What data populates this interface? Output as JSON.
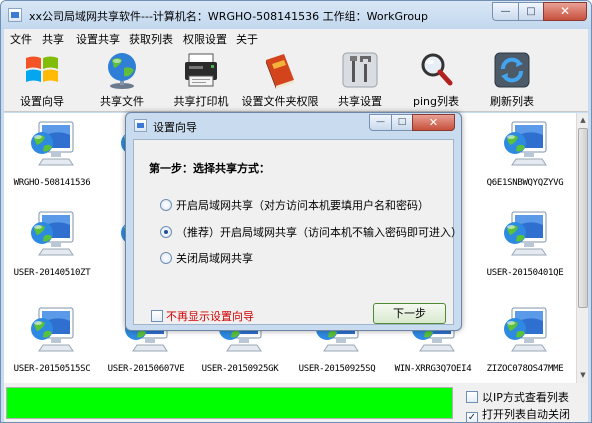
{
  "window": {
    "title": "xx公司局域网共享软件---计算机名：WRGHO-508141536  工作组：WorkGroup",
    "min_glyph": "—",
    "max_glyph": "□",
    "close_glyph": "✕"
  },
  "menu": {
    "items": [
      {
        "label": "文件"
      },
      {
        "label": "共享"
      },
      {
        "label": "设置共享"
      },
      {
        "label": "获取列表"
      },
      {
        "label": "权限设置"
      },
      {
        "label": "关于"
      }
    ]
  },
  "toolbar": {
    "items": [
      {
        "label": "设置向导",
        "icon": "windows-logo-icon"
      },
      {
        "label": "共享文件",
        "icon": "globe-icon"
      },
      {
        "label": "共享打印机",
        "icon": "printer-icon"
      },
      {
        "label": "设置文件夹权限",
        "icon": "book-icon"
      },
      {
        "label": "共享设置",
        "icon": "tools-icon"
      },
      {
        "label": "ping列表",
        "icon": "magnifier-icon"
      },
      {
        "label": "刷新列表",
        "icon": "refresh-icon"
      }
    ]
  },
  "computers": {
    "row1": [
      "WRGHO-508141536",
      "",
      "",
      "",
      "",
      "Q6E1SNBWQYQZYVG"
    ],
    "row2": [
      "USER-20140510ZT",
      "USEF",
      "",
      "",
      "QB",
      "USER-20150401QE"
    ],
    "row3": [
      "USER-20150515SC",
      "USER-20150607VE",
      "USER-20150925GK",
      "USER-20150925SQ",
      "WIN-XRRG3Q7OEI4",
      "ZIZOC078OS47MME"
    ]
  },
  "status": {
    "progress_fraction": 1.0,
    "options": [
      {
        "label": "以IP方式查看列表",
        "checked": false,
        "mark": ""
      },
      {
        "label": "打开列表自动关闭",
        "checked": true,
        "mark": "✓"
      }
    ]
  },
  "dialog": {
    "title": "设置向导",
    "step": "第一步：选择共享方式：",
    "options": [
      {
        "label": "开启局域网共享（对方访问本机要填用户名和密码）",
        "selected": false
      },
      {
        "label": "（推荐）开启局域网共享（访问本机不输入密码即可进入）",
        "selected": true
      },
      {
        "label": "关闭局域网共享",
        "selected": false
      }
    ],
    "no_show_label": "不再显示设置向导",
    "next_label": "下一步"
  },
  "colors": {
    "progress": "#00ff00",
    "warning_text": "#d00000",
    "frame": "#c9dcef"
  }
}
